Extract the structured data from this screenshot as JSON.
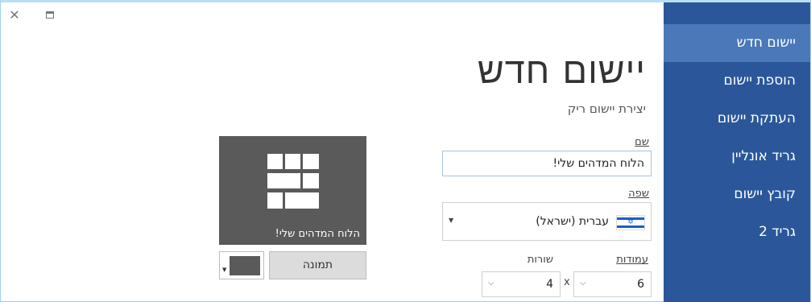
{
  "window": {
    "close_glyph": "✕",
    "maximize_icon": "maximize-icon"
  },
  "sidebar": {
    "items": [
      {
        "label": "יישום חדש",
        "active": true
      },
      {
        "label": "הוספת יישום",
        "active": false
      },
      {
        "label": "העתקת יישום",
        "active": false
      },
      {
        "label": "גריד אונליין",
        "active": false
      },
      {
        "label": "קובץ יישום",
        "active": false
      },
      {
        "label": "גריד 2",
        "active": false
      }
    ]
  },
  "main": {
    "title": "יישום חדש",
    "subtitle": "יצירת יישום ריק",
    "name_label": "שם",
    "name_value": "הלוח המדהים שלי!",
    "language_label": "שפה",
    "language_value": "עברית (ישראל)",
    "columns_label": "עמודות",
    "rows_label": "שורות",
    "columns_value": "6",
    "rows_value": "4",
    "times_sign": "x"
  },
  "preview": {
    "caption": "הלוח המדהים שלי!",
    "image_button_label": "תמונה",
    "tile_color": "#5a5a5a"
  },
  "colors": {
    "sidebar_bg": "#2b579a",
    "sidebar_active": "#4a78b9"
  }
}
